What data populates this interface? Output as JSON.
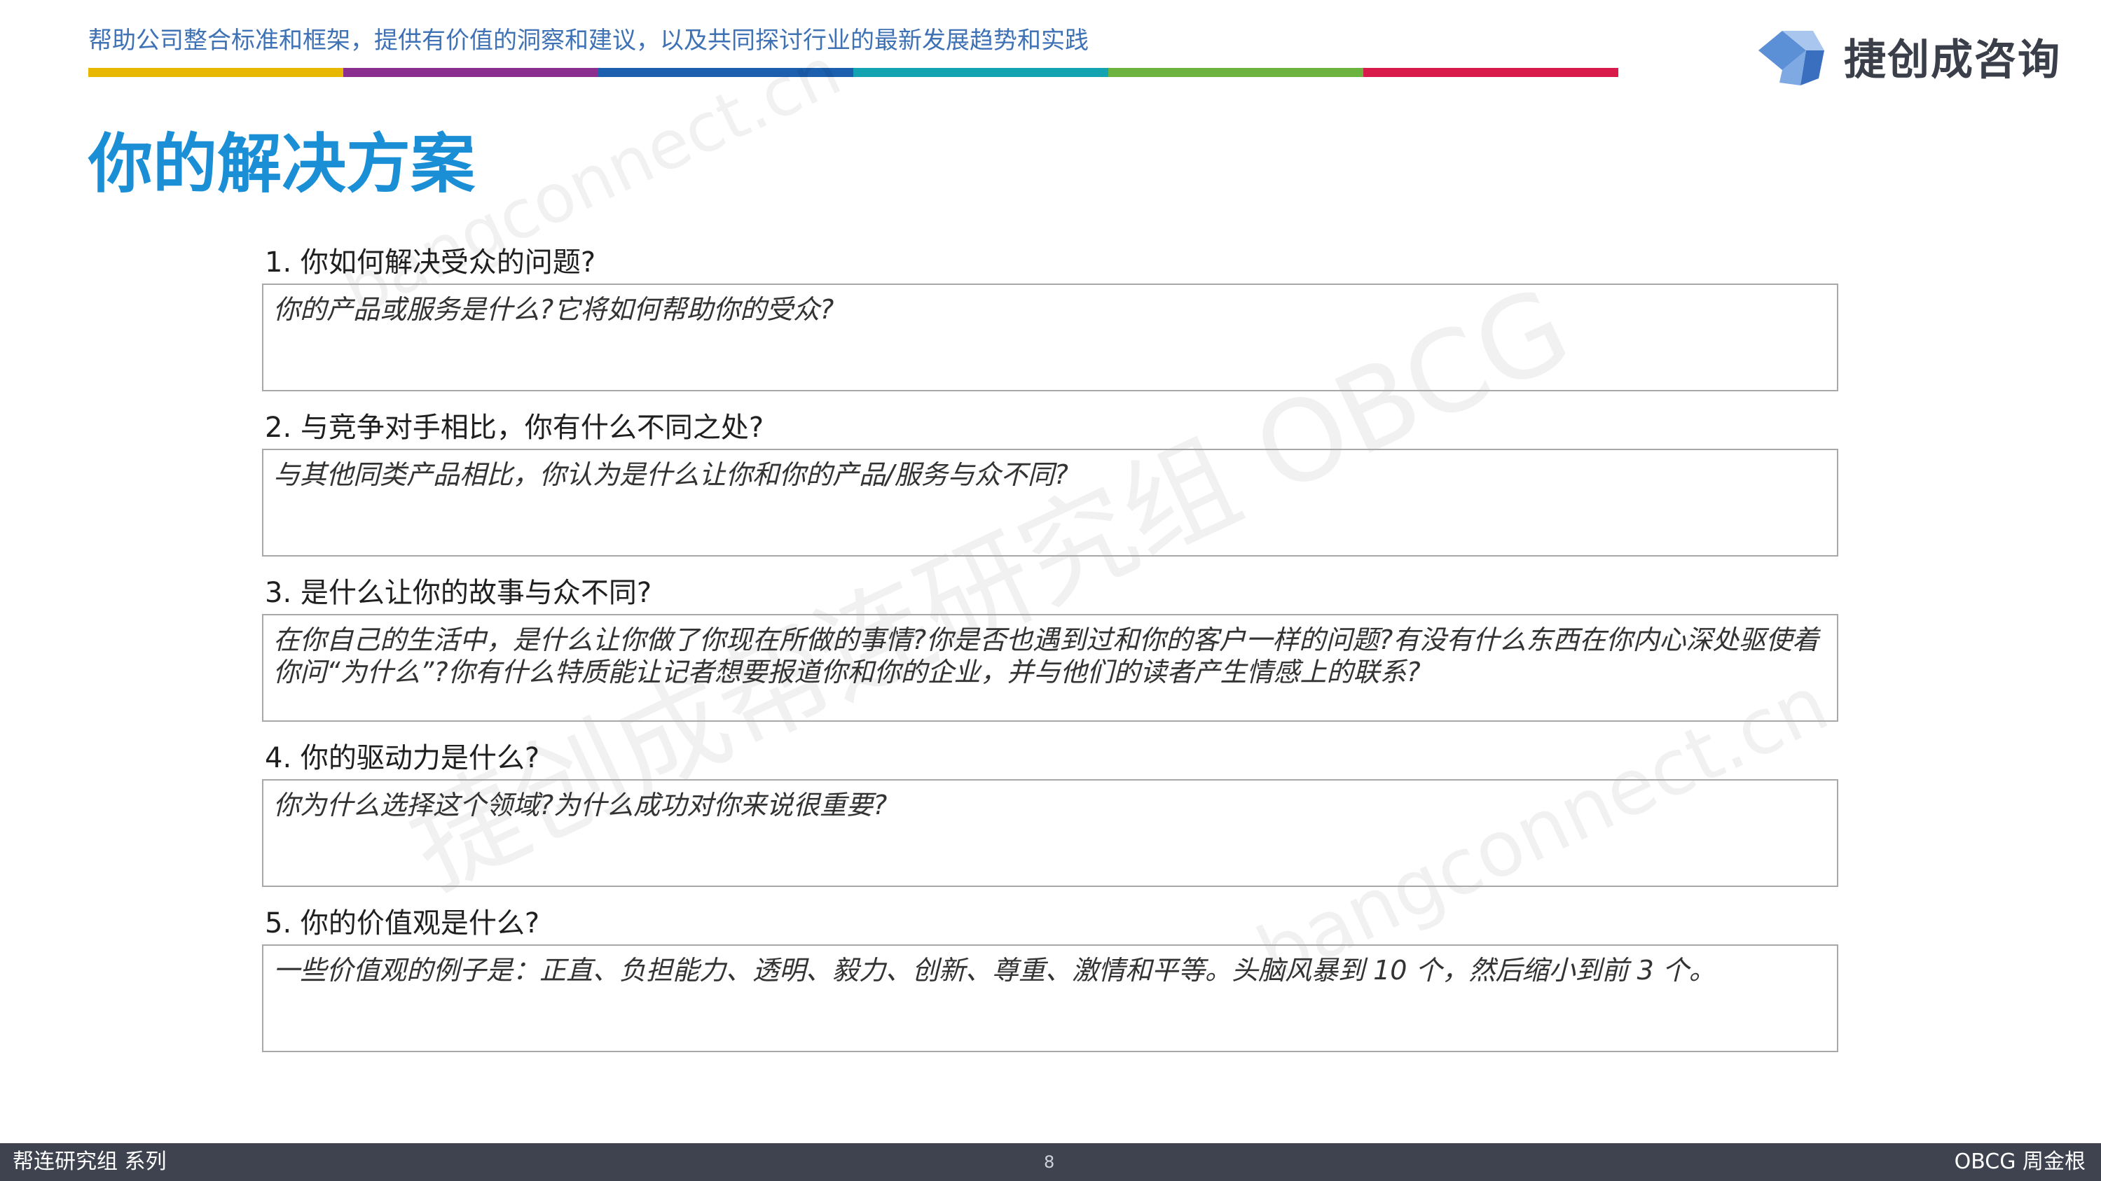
{
  "header": {
    "tagline": "帮助公司整合标准和框架，提供有价值的洞察和建议，以及共同探讨行业的最新发展趋势和实践",
    "stripe_colors": [
      "#e8b800",
      "#8a2f8f",
      "#1b5fae",
      "#14a3b0",
      "#6cb33f",
      "#d91b4b"
    ],
    "logo_text": "捷创成咨询",
    "logo_icon": "cube-logo-icon"
  },
  "page": {
    "title": "你的解决方案"
  },
  "watermarks": [
    "bangconnect.cn",
    "捷创成帮连研究组 OBCG",
    "bangconnect.cn"
  ],
  "questions": [
    {
      "label": "1. 你如何解决受众的问题?",
      "prompt": "你的产品或服务是什么?它将如何帮助你的受众?"
    },
    {
      "label": "2. 与竞争对手相比，你有什么不同之处?",
      "prompt": "与其他同类产品相比，你认为是什么让你和你的产品/服务与众不同?"
    },
    {
      "label": "3. 是什么让你的故事与众不同?",
      "prompt": "在你自己的生活中，是什么让你做了你现在所做的事情?你是否也遇到过和你的客户一样的问题?有没有什么东西在你内心深处驱使着你问“为什么”?你有什么特质能让记者想要报道你和你的企业，并与他们的读者产生情感上的联系?"
    },
    {
      "label": "4. 你的驱动力是什么?",
      "prompt": "你为什么选择这个领域?为什么成功对你来说很重要?"
    },
    {
      "label": "5. 你的价值观是什么?",
      "prompt": "一些价值观的例子是：正直、负担能力、透明、毅力、创新、尊重、激情和平等。头脑风暴到 10 个，然后缩小到前 3 个。"
    }
  ],
  "footer": {
    "left": "帮连研究组 系列",
    "page_number": "8",
    "right": "OBCG 周金根"
  }
}
